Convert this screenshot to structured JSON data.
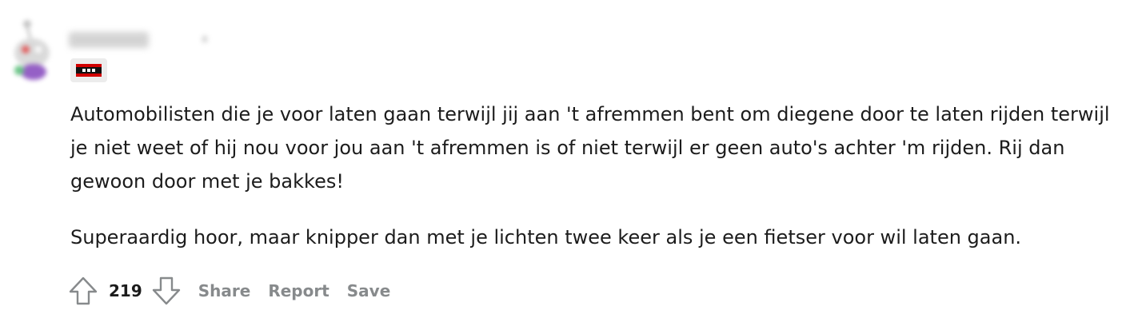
{
  "comment": {
    "flair_icon": "amsterdam-flag-icon",
    "paragraphs": [
      "Automobilisten die je voor laten gaan terwijl jij aan 't afremmen bent om diegene door te laten rijden terwijl je niet weet of hij nou voor jou aan 't afremmen is of niet terwijl er geen auto's achter 'm rijden. Rij dan gewoon door met je bakkes!",
      "Superaardig hoor, maar knipper dan met je lichten twee keer als je een fietser voor wil laten gaan."
    ],
    "score": "219",
    "actions": {
      "share": "Share",
      "report": "Report",
      "save": "Save"
    }
  },
  "colors": {
    "text": "#1c1c1c",
    "action_text": "#878a8c",
    "flag_red": "#d10000",
    "flag_black": "#111111",
    "flair_bg": "#ececec"
  }
}
